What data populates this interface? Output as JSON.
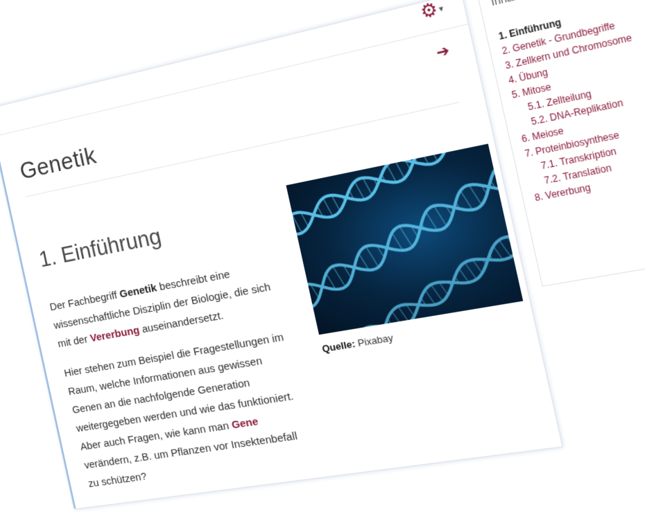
{
  "header": {
    "gear_icon": "gear-icon",
    "caret": "▾",
    "next_icon": "arrow-right-icon",
    "next_glyph": "➔"
  },
  "page": {
    "title": "Genetik"
  },
  "section": {
    "heading": "1. Einführung",
    "p1_pre": "Der Fachbegriff ",
    "p1_bold": "Genetik",
    "p1_mid": " beschreibt eine wissenschaftliche Disziplin der Biologie, die sich mit der ",
    "p1_link": "Vererbung",
    "p1_post": " auseinandersetzt.",
    "p2_pre": "Hier stehen zum Beispiel die Fragestellungen im Raum, welche Informationen aus gewissen Genen an die nachfolgende Generation weitergegeben werden und wie das funktioniert. Aber auch Fragen, wie kann man ",
    "p2_link": "Gene",
    "p2_post": " verändern, z.B. um Pflanzen vor Insektenbefall zu schützen?"
  },
  "figure": {
    "caption_label": "Quelle:",
    "caption_text": " Pixabay",
    "image_semantic": "dna-double-helix-image"
  },
  "toc": {
    "title": "Inhaltsverzeichnis",
    "items": [
      {
        "label": "1. Einführung",
        "active": true,
        "sub": false
      },
      {
        "label": "2. Genetik - Grundbegriffe",
        "active": false,
        "sub": false
      },
      {
        "label": "3. Zellkern und Chromosome",
        "active": false,
        "sub": false
      },
      {
        "label": "4. Übung",
        "active": false,
        "sub": false
      },
      {
        "label": "5. Mitose",
        "active": false,
        "sub": false
      },
      {
        "label": "5.1. Zellteilung",
        "active": false,
        "sub": true
      },
      {
        "label": "5.2. DNA-Replikation",
        "active": false,
        "sub": true
      },
      {
        "label": "6. Meiose",
        "active": false,
        "sub": false
      },
      {
        "label": "7. Proteinbiosynthese",
        "active": false,
        "sub": false
      },
      {
        "label": "7.1. Transkription",
        "active": false,
        "sub": true
      },
      {
        "label": "7.2. Translation",
        "active": false,
        "sub": true
      },
      {
        "label": "8. Vererbung",
        "active": false,
        "sub": false
      }
    ]
  },
  "colors": {
    "accent": "#8a1b3a",
    "text": "#2e2e2e",
    "image_bg": "#06243f",
    "helix": "#5ec8f0"
  }
}
